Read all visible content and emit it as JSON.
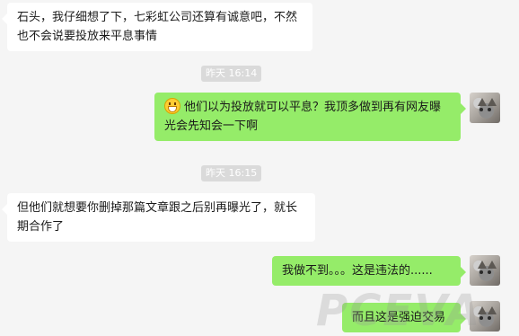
{
  "messages": [
    {
      "side": "left",
      "text": "石头，我仔细想了下，七彩虹公司还算有诚意吧，不然也不会说要投放来平息事情"
    },
    {
      "side": "time",
      "text": "昨天 16:14"
    },
    {
      "side": "right",
      "emoji": "grinning-face-emoji",
      "text": "他们以为投放就可以平息？我顶多做到再有网友曝光会先知会一下啊"
    },
    {
      "side": "time",
      "text": "昨天 16:15"
    },
    {
      "side": "left",
      "text": "但他们就想要你删掉那篇文章跟之后别再曝光了，就长期合作了"
    },
    {
      "side": "right",
      "text": "我做不到。。。这是违法的......"
    },
    {
      "side": "right",
      "text": "而且这是强迫交易"
    }
  ],
  "watermark": "PCEVA",
  "colors": {
    "background": "#f5f5f5",
    "incoming_bubble": "#ffffff",
    "outgoing_bubble": "#95ec69",
    "time_badge": "#dadada"
  }
}
